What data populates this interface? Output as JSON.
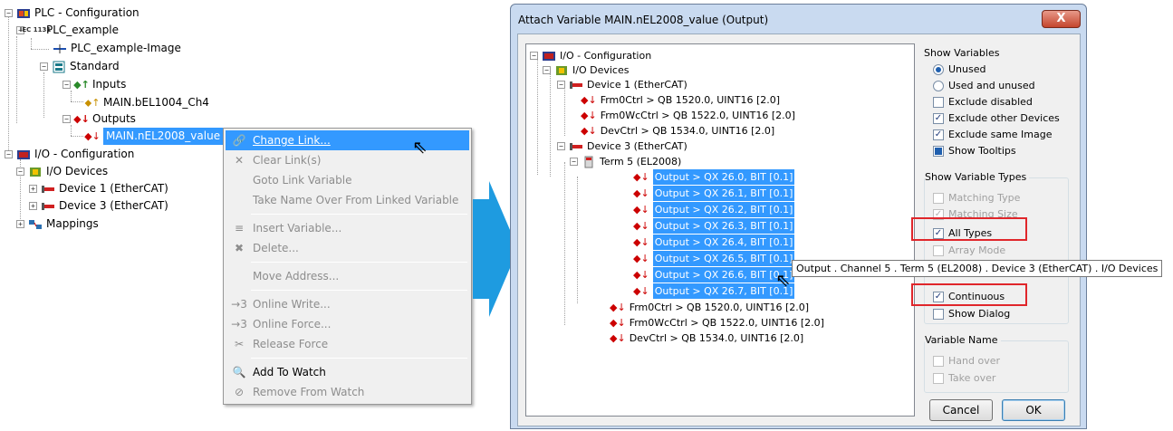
{
  "left_tree": {
    "plc_config": "PLC - Configuration",
    "plc_example": "PLC_example",
    "plc_image": "PLC_example-Image",
    "standard": "Standard",
    "inputs": "Inputs",
    "input_var": "MAIN.bEL1004_Ch4",
    "outputs": "Outputs",
    "output_var": "MAIN.nEL2008_value",
    "io_config": "I/O - Configuration",
    "io_devices": "I/O Devices",
    "device1": "Device 1 (EtherCAT)",
    "device3": "Device 3 (EtherCAT)",
    "mappings": "Mappings",
    "iec_badge": "IEC 1131"
  },
  "context_menu": {
    "items": [
      {
        "label": "Change Link...",
        "icon": "link-icon",
        "enabled": true,
        "highlighted": true
      },
      {
        "label": "Clear Link(s)",
        "icon": "clear-link-icon",
        "enabled": false
      },
      {
        "label": "Goto Link Variable",
        "icon": "",
        "enabled": false
      },
      {
        "label": "Take Name Over From Linked Variable",
        "icon": "",
        "enabled": false
      },
      {
        "label": "Insert Variable...",
        "icon": "insert-icon",
        "enabled": false
      },
      {
        "label": "Delete...",
        "icon": "delete-icon",
        "enabled": false
      },
      {
        "label": "Move Address...",
        "icon": "",
        "enabled": false
      },
      {
        "label": "Online Write...",
        "icon": "online-write-icon",
        "enabled": false
      },
      {
        "label": "Online Force...",
        "icon": "online-force-icon",
        "enabled": false
      },
      {
        "label": "Release Force",
        "icon": "release-force-icon",
        "enabled": false
      },
      {
        "label": "Add To Watch",
        "icon": "magnifier-icon",
        "enabled": true
      },
      {
        "label": "Remove From Watch",
        "icon": "remove-watch-icon",
        "enabled": false
      }
    ],
    "online_prefix": "→3"
  },
  "dialog": {
    "title": "Attach Variable MAIN.nEL2008_value (Output)",
    "close": "X",
    "tree": {
      "io_config": "I/O - Configuration",
      "io_devices": "I/O Devices",
      "device1": "Device 1 (EtherCAT)",
      "d1_rows": [
        "Frm0Ctrl  >  QB 1520.0, UINT16 [2.0]",
        "Frm0WcCtrl  >  QB 1522.0, UINT16 [2.0]",
        "DevCtrl  >  QB 1534.0, UINT16 [2.0]"
      ],
      "device3": "Device 3 (EtherCAT)",
      "term5": "Term 5 (EL2008)",
      "outputs": [
        "Output  >  QX 26.0, BIT [0.1]",
        "Output  >  QX 26.1, BIT [0.1]",
        "Output  >  QX 26.2, BIT [0.1]",
        "Output  >  QX 26.3, BIT [0.1]",
        "Output  >  QX 26.4, BIT [0.1]",
        "Output  >  QX 26.5, BIT [0.1]",
        "Output  >  QX 26.6, BIT [0.1]",
        "Output  >  QX 26.7, BIT [0.1]"
      ],
      "d3_rows": [
        "Frm0Ctrl  >  QB 1520.0, UINT16 [2.0]",
        "Frm0WcCtrl  >  QB 1522.0, UINT16 [2.0]",
        "DevCtrl  >  QB 1534.0, UINT16 [2.0]"
      ]
    },
    "tooltip": "Output . Channel 5 . Term 5 (EL2008) . Device 3 (EtherCAT) . I/O Devices",
    "show_variables": {
      "title": "Show Variables",
      "unused": "Unused",
      "used_unused": "Used and unused",
      "exclude_disabled": "Exclude disabled",
      "exclude_other": "Exclude other Devices",
      "exclude_same": "Exclude same Image",
      "show_tooltips": "Show Tooltips"
    },
    "show_types": {
      "title": "Show Variable Types",
      "matching_type": "Matching Type",
      "matching_size": "Matching Size",
      "all_types": "All Types",
      "array_mode": "Array Mode",
      "continuous": "Continuous",
      "show_dialog": "Show Dialog"
    },
    "variable_name": {
      "title": "Variable Name",
      "hand_over": "Hand over",
      "take_over": "Take over"
    },
    "cancel": "Cancel",
    "ok": "OK",
    "check": "✓"
  },
  "colors": {
    "selection": "#3399ff",
    "highlight_box": "#e0262b",
    "arrow": "#1e9be0"
  }
}
